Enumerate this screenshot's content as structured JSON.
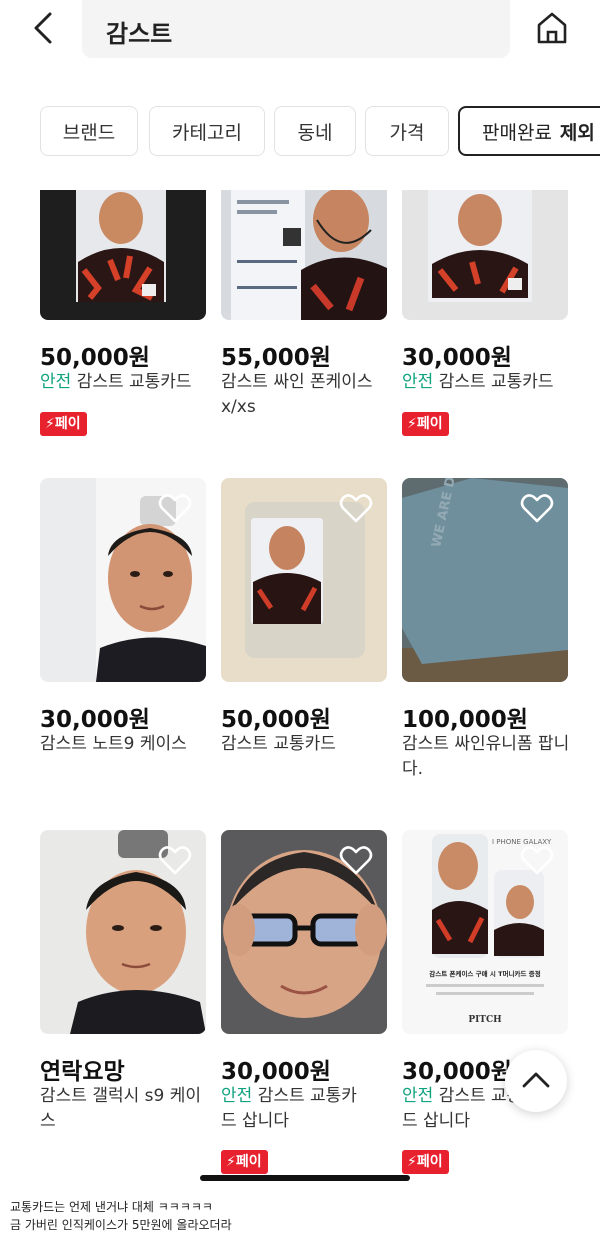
{
  "search": {
    "query": "감스트"
  },
  "filters": [
    {
      "label": "브랜드"
    },
    {
      "label": "카테고리"
    },
    {
      "label": "동네"
    },
    {
      "label": "가격"
    },
    {
      "label": "판매완료",
      "bold_label": "제외"
    }
  ],
  "items": [
    {
      "price": "50,000원",
      "safe": "안전",
      "title": "감스트 교통카드",
      "pay": "페이"
    },
    {
      "price": "55,000원",
      "safe": "",
      "title": "감스트 싸인 폰케이스 x/xs",
      "pay": ""
    },
    {
      "price": "30,000원",
      "safe": "안전",
      "title": "감스트 교통카드",
      "pay": "페이"
    },
    {
      "price": "30,000원",
      "safe": "",
      "title": "감스트 노트9 케이스",
      "pay": ""
    },
    {
      "price": "50,000원",
      "safe": "",
      "title": "감스트 교통카드",
      "pay": ""
    },
    {
      "price": "100,000원",
      "safe": "",
      "title": "감스트 싸인유니폼 팝니다.",
      "pay": ""
    },
    {
      "price": "연락요망",
      "safe": "",
      "title": "감스트 갤럭시 s9 케이스",
      "pay": ""
    },
    {
      "price": "30,000원",
      "safe": "안전",
      "title": "감스트 교통카드 삽니다",
      "pay": "페이"
    },
    {
      "price": "30,000원",
      "safe": "안전",
      "title": "감스트 교통카드 삽니다",
      "pay": "페이"
    }
  ],
  "image_text": {
    "shirt": "WE ARE DAEGU",
    "phone_labels": "I PHONE GALAXY",
    "promo": "감스트 폰케이스 구매 시 T머니카드 증정",
    "brand": "PITCH"
  },
  "caption": {
    "line1": "교통카드는 언제 낸거냐 대체 ㅋㅋㅋㅋㅋ",
    "line2": "금 가버린 인직케이스가 5만원에 올라오더라"
  },
  "colors": {
    "safe": "#10a37f",
    "pay": "#e8212f"
  }
}
